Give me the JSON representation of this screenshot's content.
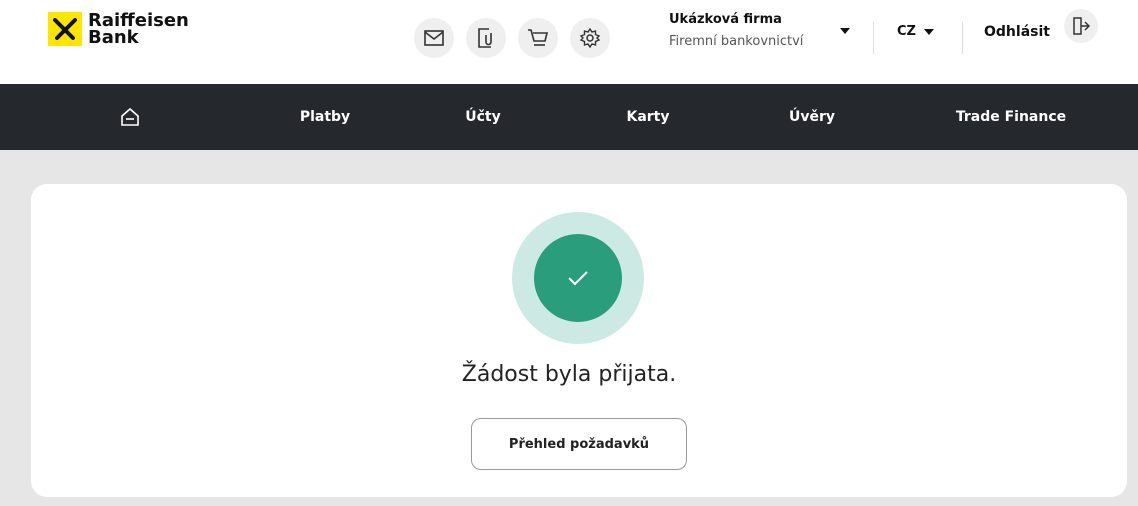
{
  "brand": {
    "line1": "Raiffeisen",
    "line2": "Bank",
    "yellow": "#fee600"
  },
  "header": {
    "icons": [
      "mail-icon",
      "document-attachment-icon",
      "cart-icon",
      "settings-icon"
    ],
    "company_name": "Ukázková firma",
    "company_segment": "Firemní bankovnictví",
    "language": "CZ",
    "logout_label": "Odhlásit"
  },
  "nav": {
    "home_icon": "home-icon",
    "items": [
      {
        "label": "Platby"
      },
      {
        "label": "Účty"
      },
      {
        "label": "Karty"
      },
      {
        "label": "Úvěry"
      },
      {
        "label": "Trade Finance"
      }
    ],
    "background": "#25282d"
  },
  "main": {
    "status_icon": "check-icon",
    "success_color": "#2a9d7c",
    "message": "Žádost byla přijata.",
    "button_label": "Přehled požadavků"
  }
}
